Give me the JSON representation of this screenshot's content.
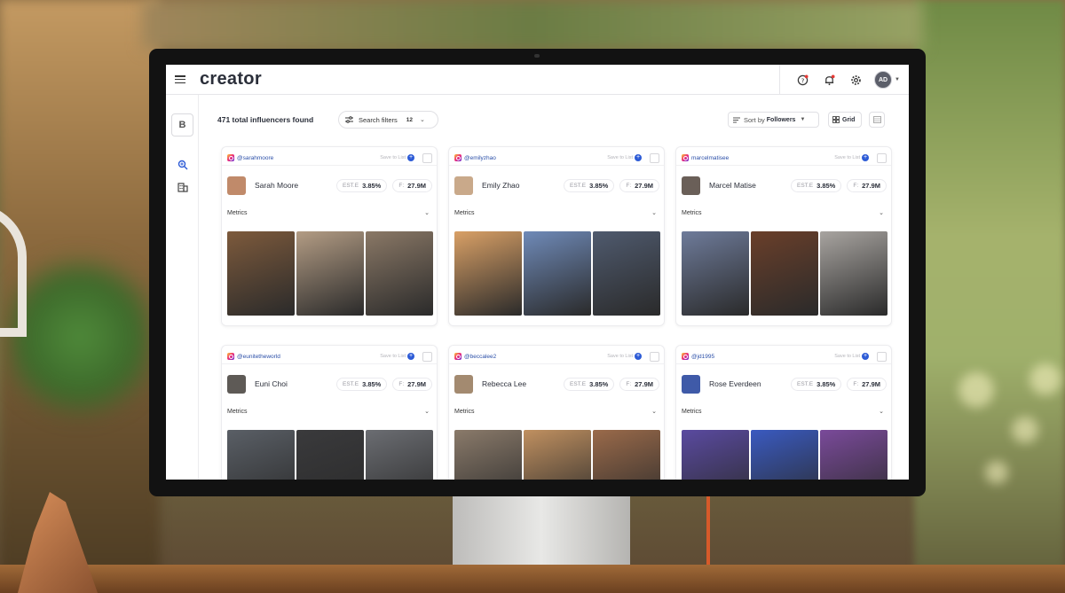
{
  "app": {
    "logo": "creator",
    "avatar_initials": "AD",
    "brand_initial": "B"
  },
  "toolbar": {
    "result_count": "471 total influencers found",
    "filter_label": "Search filters",
    "filter_count": "12",
    "sort_prefix": "Sort by",
    "sort_value": "Followers",
    "grid_label": "Grid"
  },
  "labels": {
    "save_to_list": "Save to List",
    "metrics": "Metrics",
    "er_label": "EST.E",
    "followers_label": "F:"
  },
  "colors": {
    "accent": "#2d5bd6",
    "handle": "#2b4fa8",
    "text": "#2b2f3a"
  },
  "cards": [
    {
      "handle": "@sarahmoore",
      "name": "Sarah Moore",
      "er": "3.85%",
      "followers": "27.9M",
      "thumb": "#c08a6a",
      "photos": [
        "#7d5a3c",
        "#b39c84",
        "#8a7866"
      ]
    },
    {
      "handle": "@emilyzhao",
      "name": "Emily Zhao",
      "er": "3.85%",
      "followers": "27.9M",
      "thumb": "#c9a98a",
      "photos": [
        "#d9a066",
        "#6f8ab8",
        "#4f5a6e"
      ]
    },
    {
      "handle": "marcelmatisee",
      "name": "Marcel Matise",
      "er": "3.85%",
      "followers": "27.9M",
      "thumb": "#6a5f58",
      "photos": [
        "#6e7b9a",
        "#6a3f2a",
        "#a8a4a0"
      ]
    },
    {
      "handle": "@eunitetheworld",
      "name": "Euni Choi",
      "er": "3.85%",
      "followers": "27.9M",
      "thumb": "#5e5a56",
      "photos": [
        "#5a5f66",
        "#3a3a3c",
        "#6b6d72"
      ]
    },
    {
      "handle": "@beccalee2",
      "name": "Rebecca Lee",
      "er": "3.85%",
      "followers": "27.9M",
      "thumb": "#a38a70",
      "photos": [
        "#8a7a6a",
        "#c09060",
        "#9a6a4a"
      ]
    },
    {
      "handle": "@jd1995",
      "name": "Rose Everdeen",
      "er": "3.85%",
      "followers": "27.9M",
      "thumb": "#3f5aa8",
      "photos": [
        "#5a4aa0",
        "#3a5ac0",
        "#7a4a9a"
      ]
    }
  ]
}
